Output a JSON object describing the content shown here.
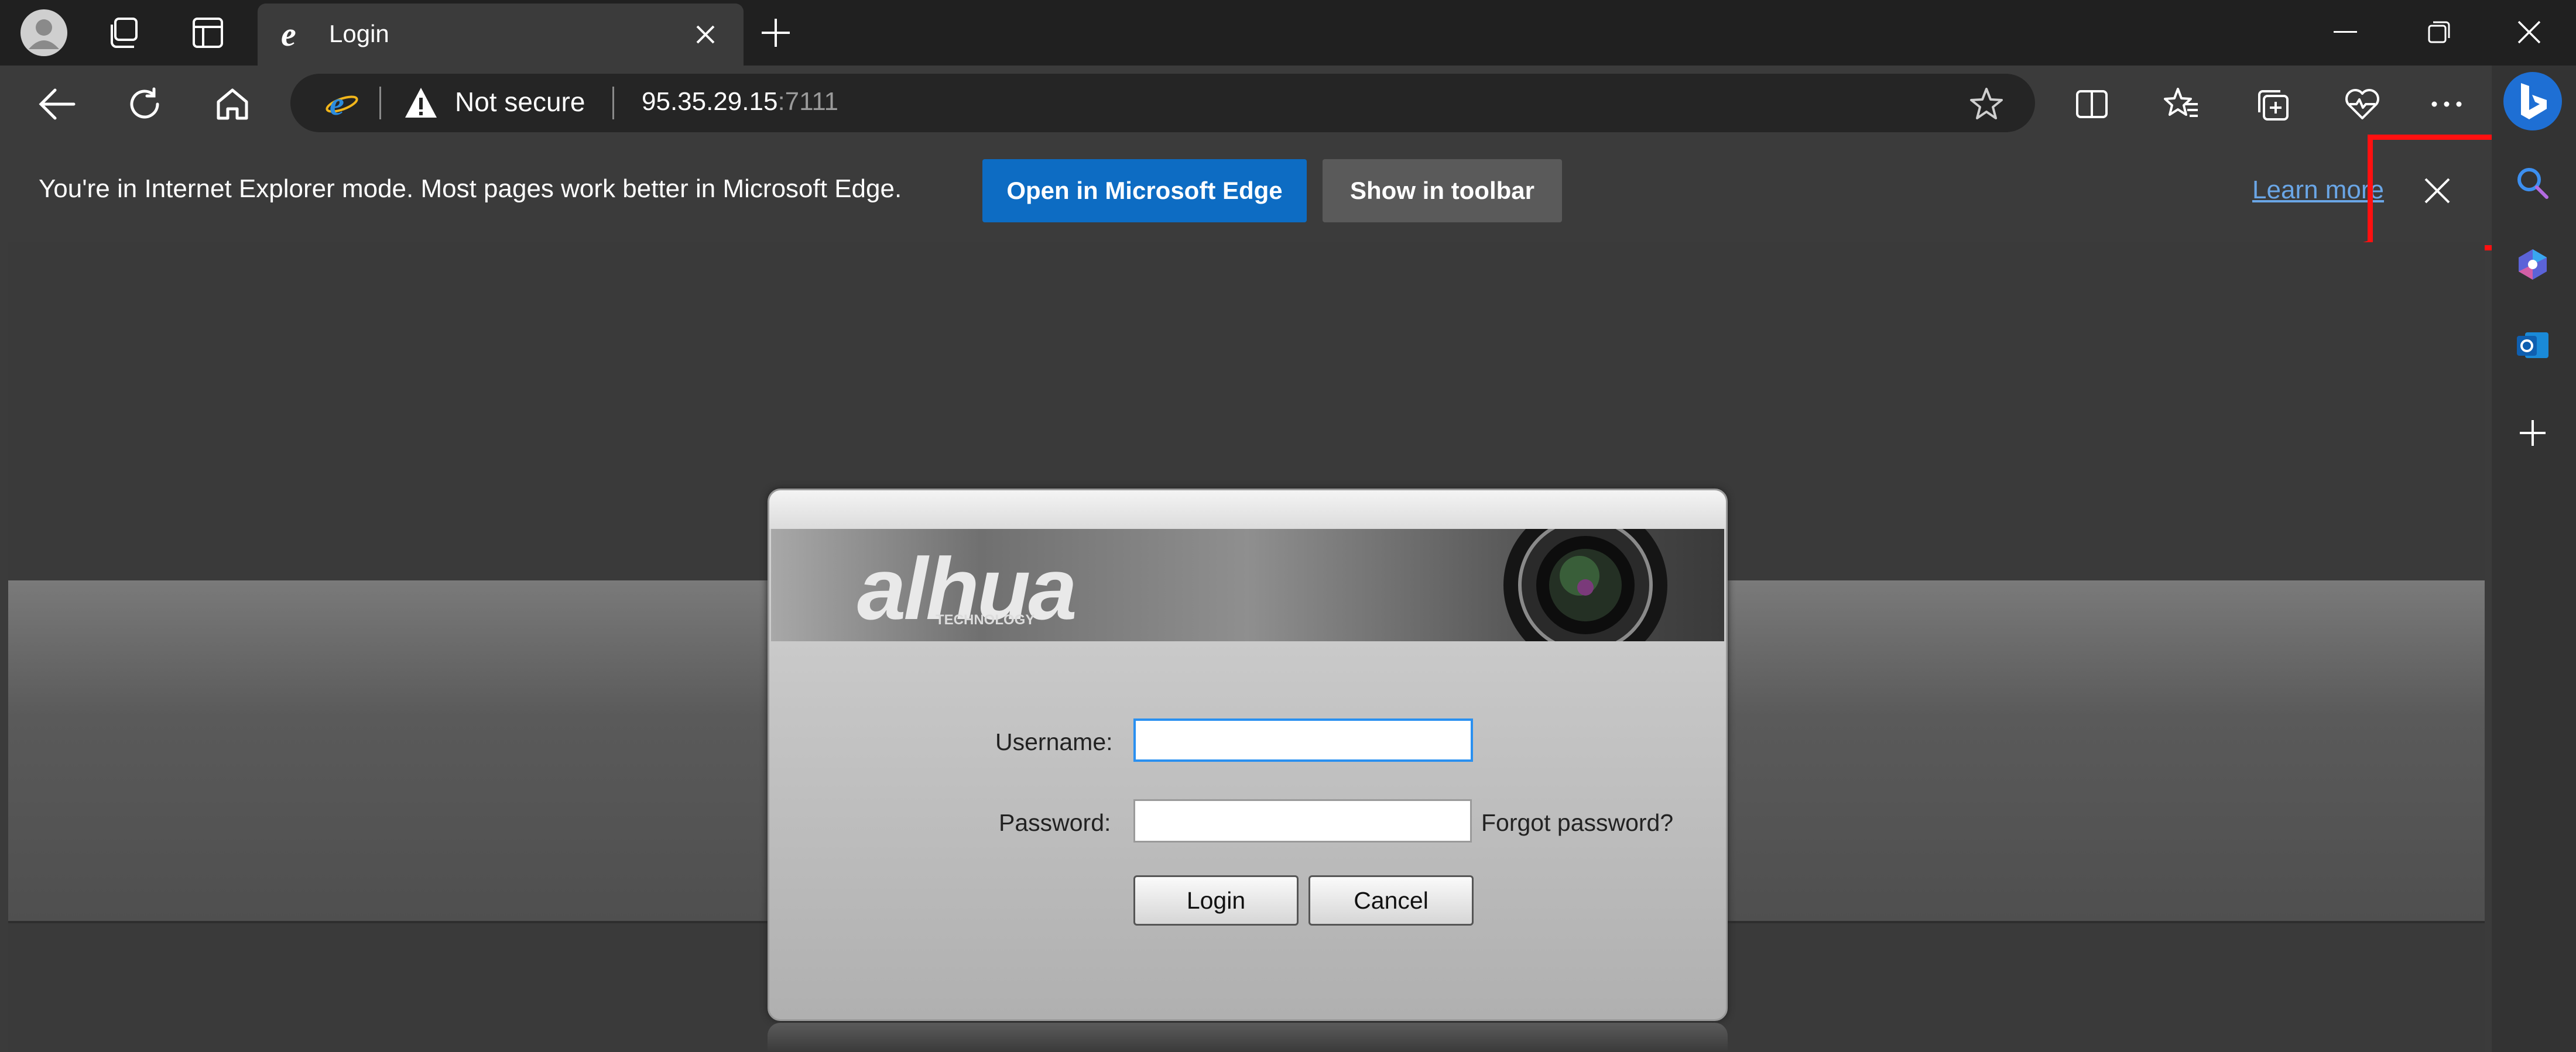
{
  "browser": {
    "tab_title": "Login",
    "address": {
      "security_label": "Not secure",
      "host": "95.35.29.15",
      "port": ":7111"
    },
    "icons": [
      "profile-icon",
      "workspaces-icon",
      "tab-actions-icon",
      "ie-icon",
      "close-icon",
      "new-tab-icon",
      "minimize-icon",
      "restore-icon",
      "back-icon",
      "refresh-icon",
      "home-icon",
      "warning-icon",
      "favorite-star-icon",
      "split-screen-icon",
      "favorites-icon",
      "collections-icon",
      "performance-icon",
      "more-icon",
      "bing-icon",
      "search-icon",
      "copilot-icon",
      "outlook-icon",
      "add-icon"
    ]
  },
  "infobar": {
    "message": "You're in Internet Explorer mode. Most pages work better in Microsoft Edge.",
    "open_edge_label": "Open in Microsoft Edge",
    "show_toolbar_label": "Show in toolbar",
    "learn_more_label": "Learn more"
  },
  "login": {
    "brand": "alhua",
    "brand_sub": "TECHNOLOGY",
    "username_label": "Username:",
    "username_value": "",
    "password_label": "Password:",
    "password_value": "",
    "forgot_label": "Forgot password?",
    "login_button": "Login",
    "cancel_button": "Cancel"
  },
  "colors": {
    "tabstrip": "#202020",
    "toolbar": "#3b3b3b",
    "accent_blue": "#0d6cc3",
    "annotation_red": "#ff1010"
  }
}
